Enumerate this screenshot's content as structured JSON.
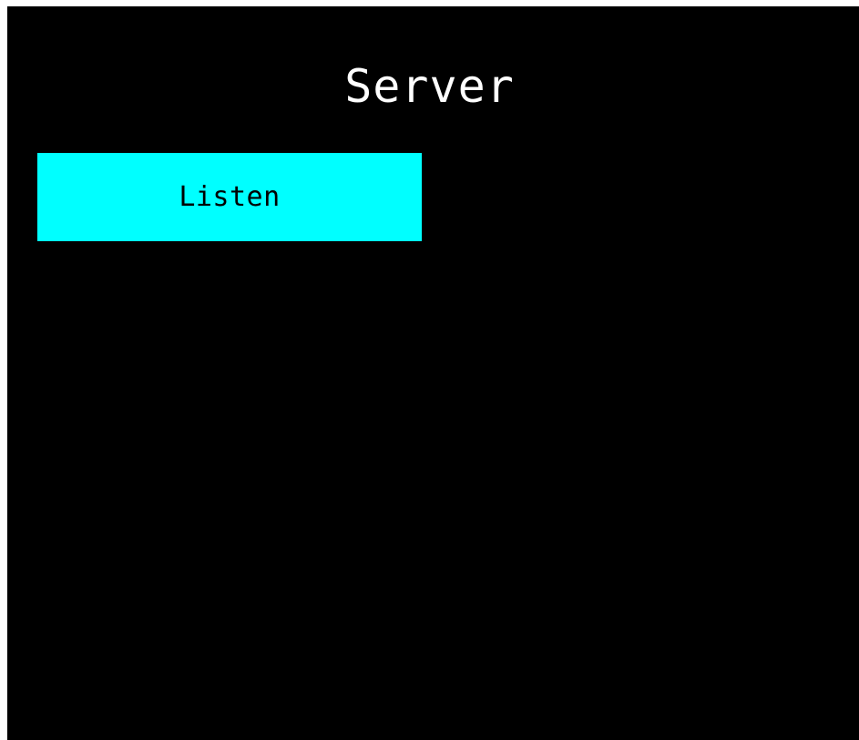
{
  "app": {
    "title": "Server"
  },
  "actions": {
    "listen_label": "Listen"
  },
  "colors": {
    "background": "#000000",
    "title_text": "#ffffff",
    "button_background": "#00ffff",
    "button_text": "#000000"
  }
}
